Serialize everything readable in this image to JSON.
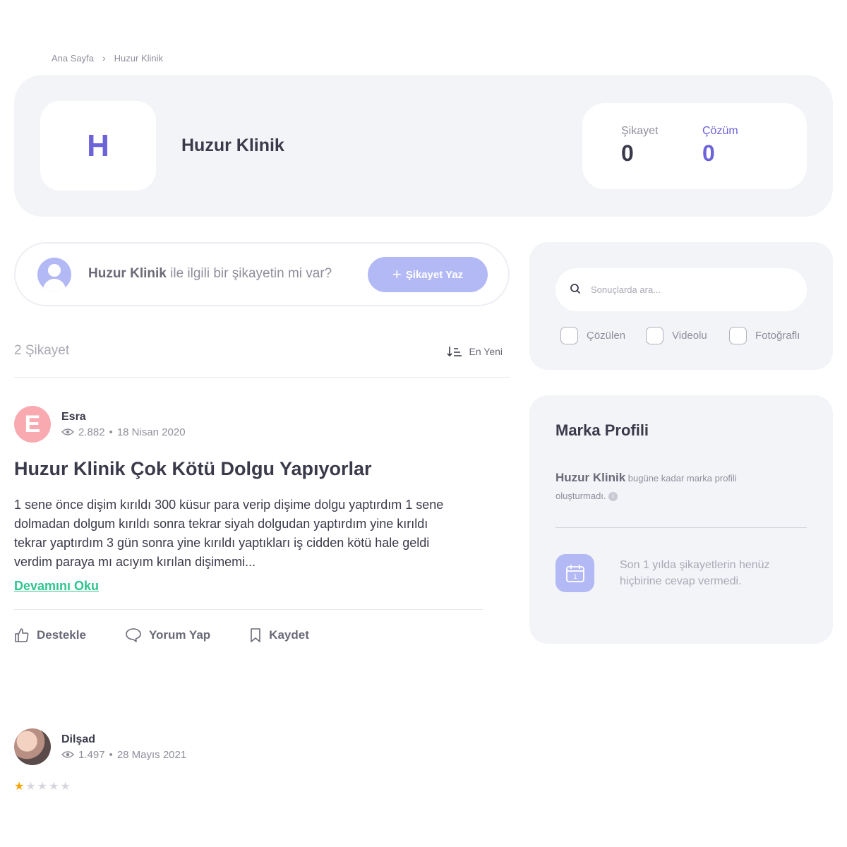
{
  "breadcrumb": {
    "home": "Ana Sayfa",
    "separator": "›",
    "current": "Huzur Klinik"
  },
  "brand": {
    "initial": "H",
    "name": "Huzur Klinik",
    "stats": [
      {
        "label": "Şikayet",
        "value": "0"
      },
      {
        "label": "Çözüm",
        "value": "0"
      }
    ]
  },
  "ask": {
    "brand": "Huzur Klinik",
    "text": " ile ilgili bir şikayetin mi var?",
    "button_plus": "+",
    "button_label": "Şikayet Yaz"
  },
  "list": {
    "count": "2 Şikayet",
    "sort_label": "En Yeni"
  },
  "search": {
    "placeholder": "Sonuçlarda ara...",
    "filters": [
      "Çözülen",
      "Videolu",
      "Fotoğraflı"
    ]
  },
  "profile": {
    "title": "Marka Profili",
    "brand": "Huzur Klinik",
    "text": " bugüne kadar marka profili oluşturmadı.",
    "calendar_day": "1",
    "note": "Son 1 yılda şikayetlerin henüz hiçbirine cevap vermedi."
  },
  "posts": [
    {
      "author": "Esra",
      "avatar_initial": "E",
      "views": "2.882",
      "date": "18 Nisan 2020",
      "title": "Huzur Klinik Çok Kötü Dolgu Yapıyorlar",
      "body": "1 sene önce dişim kırıldı 300 küsur para verip dişime dolgu yaptırdım 1 sene dolmadan dolgum kırıldı sonra tekrar siyah dolgudan yaptırdım yine kırıldı tekrar yaptırdım 3 gün sonra yine kırıldı yaptıkları iş cidden kötü hale geldi verdim paraya mı acıyım kırılan dişimemi...",
      "read_more": "Devamını Oku",
      "actions": [
        "Destekle",
        "Yorum Yap",
        "Kaydet"
      ]
    },
    {
      "author": "Dilşad",
      "views": "1.497",
      "date": "28 Mayıs 2021",
      "rating": 1,
      "rating_max": 5
    }
  ],
  "colors": {
    "accent": "#6c63d9",
    "button": "#b3b9f4",
    "link": "#2fc58f",
    "star": "#f4a300",
    "card_bg": "#f3f4f8"
  }
}
